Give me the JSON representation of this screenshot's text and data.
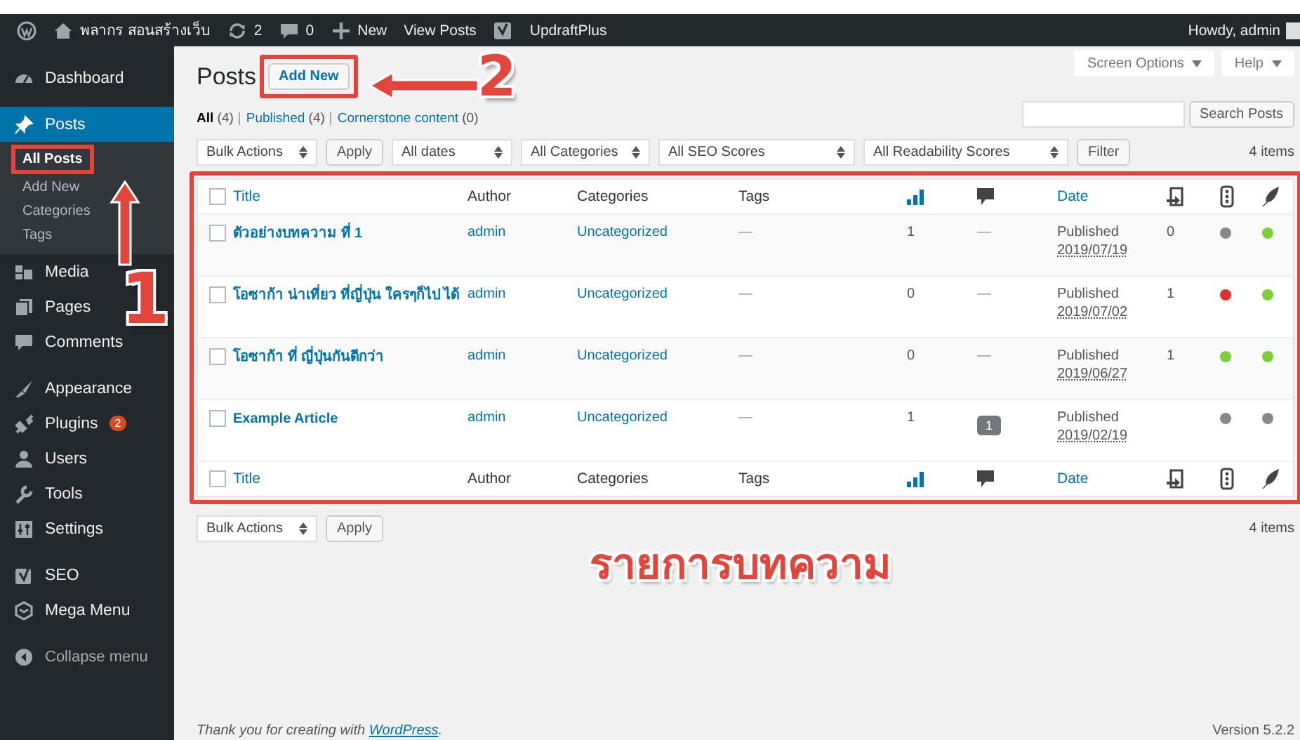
{
  "admin_bar": {
    "items": [
      {
        "kind": "logo"
      },
      {
        "kind": "site",
        "label": "พลากร สอนสร้างเว็บ"
      },
      {
        "kind": "updates",
        "label": "2"
      },
      {
        "kind": "comments",
        "label": "0"
      },
      {
        "kind": "new",
        "label": "New"
      },
      {
        "kind": "link",
        "label": "View Posts"
      },
      {
        "kind": "yoast"
      },
      {
        "kind": "link",
        "label": "UpdraftPlus"
      }
    ],
    "greeting": "Howdy, admin"
  },
  "sidebar": {
    "sections": [
      {
        "items": [
          {
            "label": "Dashboard",
            "current": false
          }
        ]
      },
      {
        "items": [
          {
            "label": "Posts",
            "current": true,
            "children": [
              {
                "label": "All Posts",
                "selected": true,
                "highlighted": true
              },
              {
                "label": "Add New",
                "selected": false
              },
              {
                "label": "Categories",
                "selected": false
              },
              {
                "label": "Tags",
                "selected": false
              }
            ]
          },
          {
            "label": "Media",
            "current": false
          },
          {
            "label": "Pages",
            "current": false
          },
          {
            "label": "Comments",
            "current": false
          }
        ]
      },
      {
        "items": [
          {
            "label": "Appearance",
            "current": false
          },
          {
            "label": "Plugins",
            "current": false,
            "badge": "2"
          },
          {
            "label": "Users",
            "current": false
          },
          {
            "label": "Tools",
            "current": false
          },
          {
            "label": "Settings",
            "current": false
          }
        ]
      },
      {
        "items": [
          {
            "label": "SEO",
            "current": false
          },
          {
            "label": "Mega Menu",
            "current": false
          }
        ]
      }
    ],
    "collapse_label": "Collapse menu"
  },
  "page": {
    "title": "Posts",
    "add_new": {
      "label": "Add New",
      "highlighted": true
    },
    "screen_buttons": [
      "Screen Options",
      "Help"
    ],
    "views": [
      {
        "label": "All",
        "count": "(4)",
        "selected": true
      },
      {
        "label": "Published",
        "count": "(4)",
        "selected": false
      },
      {
        "label": "Cornerstone content",
        "count": "(0)",
        "selected": false
      }
    ],
    "search_button": "Search Posts",
    "filters": {
      "bulk": "Bulk Actions",
      "apply": "Apply",
      "selects": [
        "All dates",
        "All Categories",
        "All SEO Scores",
        "All Readability Scores"
      ],
      "filter": "Filter",
      "count": "4 items"
    },
    "table": {
      "highlighted": true,
      "header": [
        {
          "kind": "check",
          "checked": false
        },
        {
          "kind": "text",
          "label": "Title",
          "sortable": true
        },
        {
          "kind": "text",
          "label": "Author",
          "sortable": false
        },
        {
          "kind": "text",
          "label": "Categories",
          "sortable": false
        },
        {
          "kind": "text",
          "label": "Tags",
          "sortable": false
        },
        {
          "kind": "icon"
        },
        {
          "kind": "icon"
        },
        {
          "kind": "text",
          "label": "Date",
          "sortable": true
        },
        {
          "kind": "icon"
        },
        {
          "kind": "icon"
        },
        {
          "kind": "icon"
        }
      ],
      "rows": [
        {
          "checked": false,
          "title": "ตัวอย่างบทความ ที่ 1",
          "author": "admin",
          "category": "Uncategorized",
          "tags": "—",
          "links": "1",
          "comments": {
            "kind": "none",
            "text": "—"
          },
          "status": "Published",
          "date": "2019/07/19",
          "linked": "0",
          "scores": [
            {
              "color": "#888888"
            },
            {
              "color": "#7ad03a"
            }
          ]
        },
        {
          "checked": false,
          "title": "โอซาก้า น่าเที่ยว ที่ญี่ปุ่น ใครๆก็ไป ได้",
          "author": "admin",
          "category": "Uncategorized",
          "tags": "—",
          "links": "0",
          "comments": {
            "kind": "none",
            "text": "—"
          },
          "status": "Published",
          "date": "2019/07/02",
          "linked": "1",
          "scores": [
            {
              "color": "#dc3232"
            },
            {
              "color": "#7ad03a"
            }
          ]
        },
        {
          "checked": false,
          "title": "โอซาก้า ที่ ญี่ปุ่นกันดีกว่า",
          "author": "admin",
          "category": "Uncategorized",
          "tags": "—",
          "links": "0",
          "comments": {
            "kind": "none",
            "text": "—"
          },
          "status": "Published",
          "date": "2019/06/27",
          "linked": "1",
          "scores": [
            {
              "color": "#7ad03a"
            },
            {
              "color": "#7ad03a"
            }
          ]
        },
        {
          "checked": false,
          "title": "Example Article",
          "author": "admin",
          "category": "Uncategorized",
          "tags": "—",
          "links": "1",
          "comments": {
            "kind": "bubble",
            "text": "1"
          },
          "status": "Published",
          "date": "2019/02/19",
          "scores": [
            {
              "color": "#888888"
            },
            {
              "color": "#888888"
            }
          ]
        }
      ],
      "footer": [
        {
          "kind": "check",
          "checked": false
        },
        {
          "kind": "text",
          "label": "Title",
          "sortable": true
        },
        {
          "kind": "text",
          "label": "Author",
          "sortable": false
        },
        {
          "kind": "text",
          "label": "Categories",
          "sortable": false
        },
        {
          "kind": "text",
          "label": "Tags",
          "sortable": false
        },
        {
          "kind": "icon"
        },
        {
          "kind": "icon"
        },
        {
          "kind": "text",
          "label": "Date",
          "sortable": true
        },
        {
          "kind": "icon"
        },
        {
          "kind": "icon"
        },
        {
          "kind": "icon"
        }
      ]
    },
    "bottom": {
      "bulk": "Bulk Actions",
      "apply": "Apply",
      "count": "4 items"
    },
    "footer": {
      "before": "Thank you for creating with",
      "link": "WordPress",
      "after": ".",
      "version": "Version 5.2.2"
    }
  },
  "annotations": {
    "markers": [
      {
        "label": "1"
      },
      {
        "label": "2"
      }
    ],
    "caption": "รายการบทความ"
  }
}
